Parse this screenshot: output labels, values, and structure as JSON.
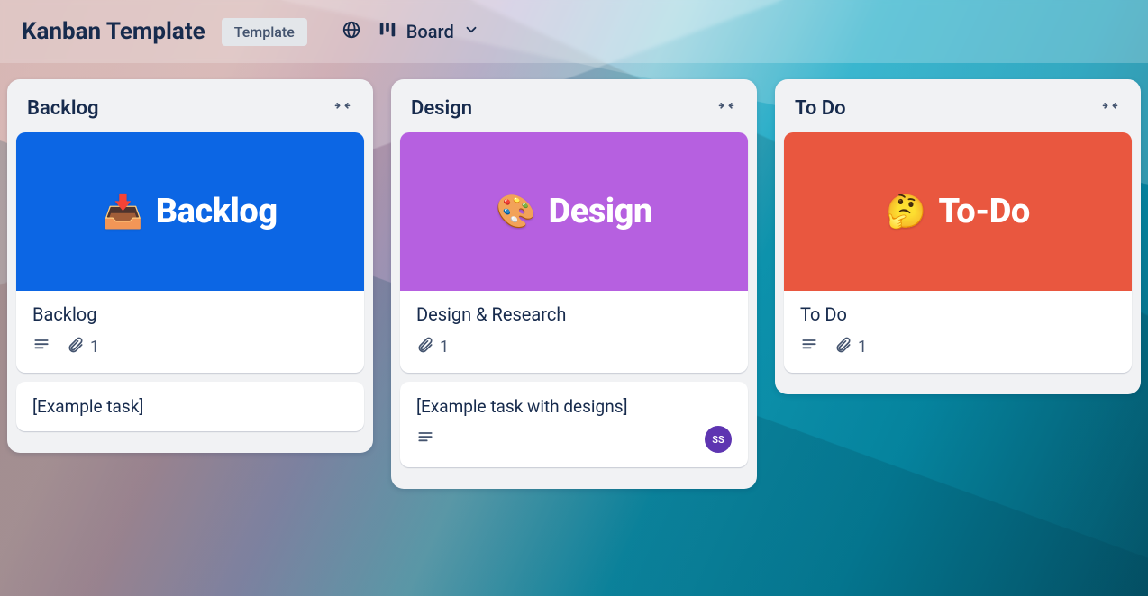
{
  "header": {
    "title": "Kanban Template",
    "template_badge": "Template",
    "view_label": "Board"
  },
  "lists": [
    {
      "title": "Backlog",
      "cover": {
        "emoji": "📥",
        "text": "Backlog",
        "bg": "#0c66e4"
      },
      "hero_card": {
        "title": "Backlog",
        "has_description": true,
        "attachments": "1"
      },
      "cards": [
        {
          "title": "[Example task]",
          "has_description": false,
          "avatar": null
        }
      ]
    },
    {
      "title": "Design",
      "cover": {
        "emoji": "🎨",
        "text": "Design",
        "bg": "#b660e0"
      },
      "hero_card": {
        "title": "Design & Research",
        "has_description": false,
        "attachments": "1"
      },
      "cards": [
        {
          "title": "[Example task with designs]",
          "has_description": true,
          "avatar": "SS"
        }
      ]
    },
    {
      "title": "To Do",
      "cover": {
        "emoji": "🤔",
        "text": "To-Do",
        "bg": "#e9573f"
      },
      "hero_card": {
        "title": "To Do",
        "has_description": true,
        "attachments": "1"
      },
      "cards": []
    }
  ],
  "colors": {
    "avatar_bg": "#5e35b1"
  }
}
